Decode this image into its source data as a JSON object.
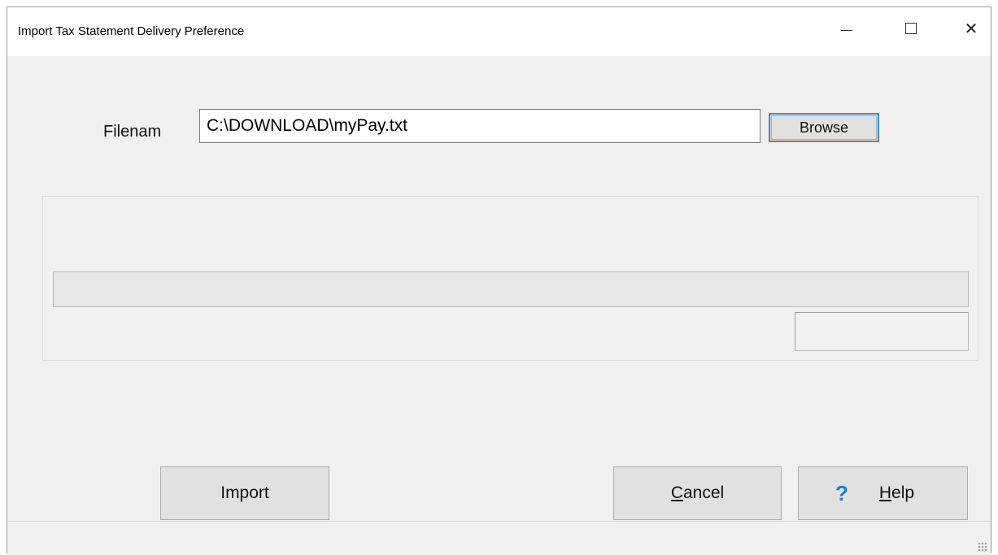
{
  "window": {
    "title": "Import Tax Statement Delivery Preference",
    "minimize_icon": "minimize-icon",
    "maximize_icon": "maximize-icon",
    "close_icon": "close-icon"
  },
  "form": {
    "filename_label": "Filenam",
    "filename_value": "C:\\DOWNLOAD\\myPay.txt",
    "browse_label": "Browse"
  },
  "progress": {
    "value_percent": 0,
    "status_text": ""
  },
  "buttons": {
    "import_label": "Import",
    "cancel_label": "Cancel",
    "cancel_accel": "C",
    "cancel_rest": "ancel",
    "help_label": "Help",
    "help_accel": "H",
    "help_rest": "elp",
    "help_icon": "question-icon",
    "help_icon_color": "#1e7bd8"
  }
}
